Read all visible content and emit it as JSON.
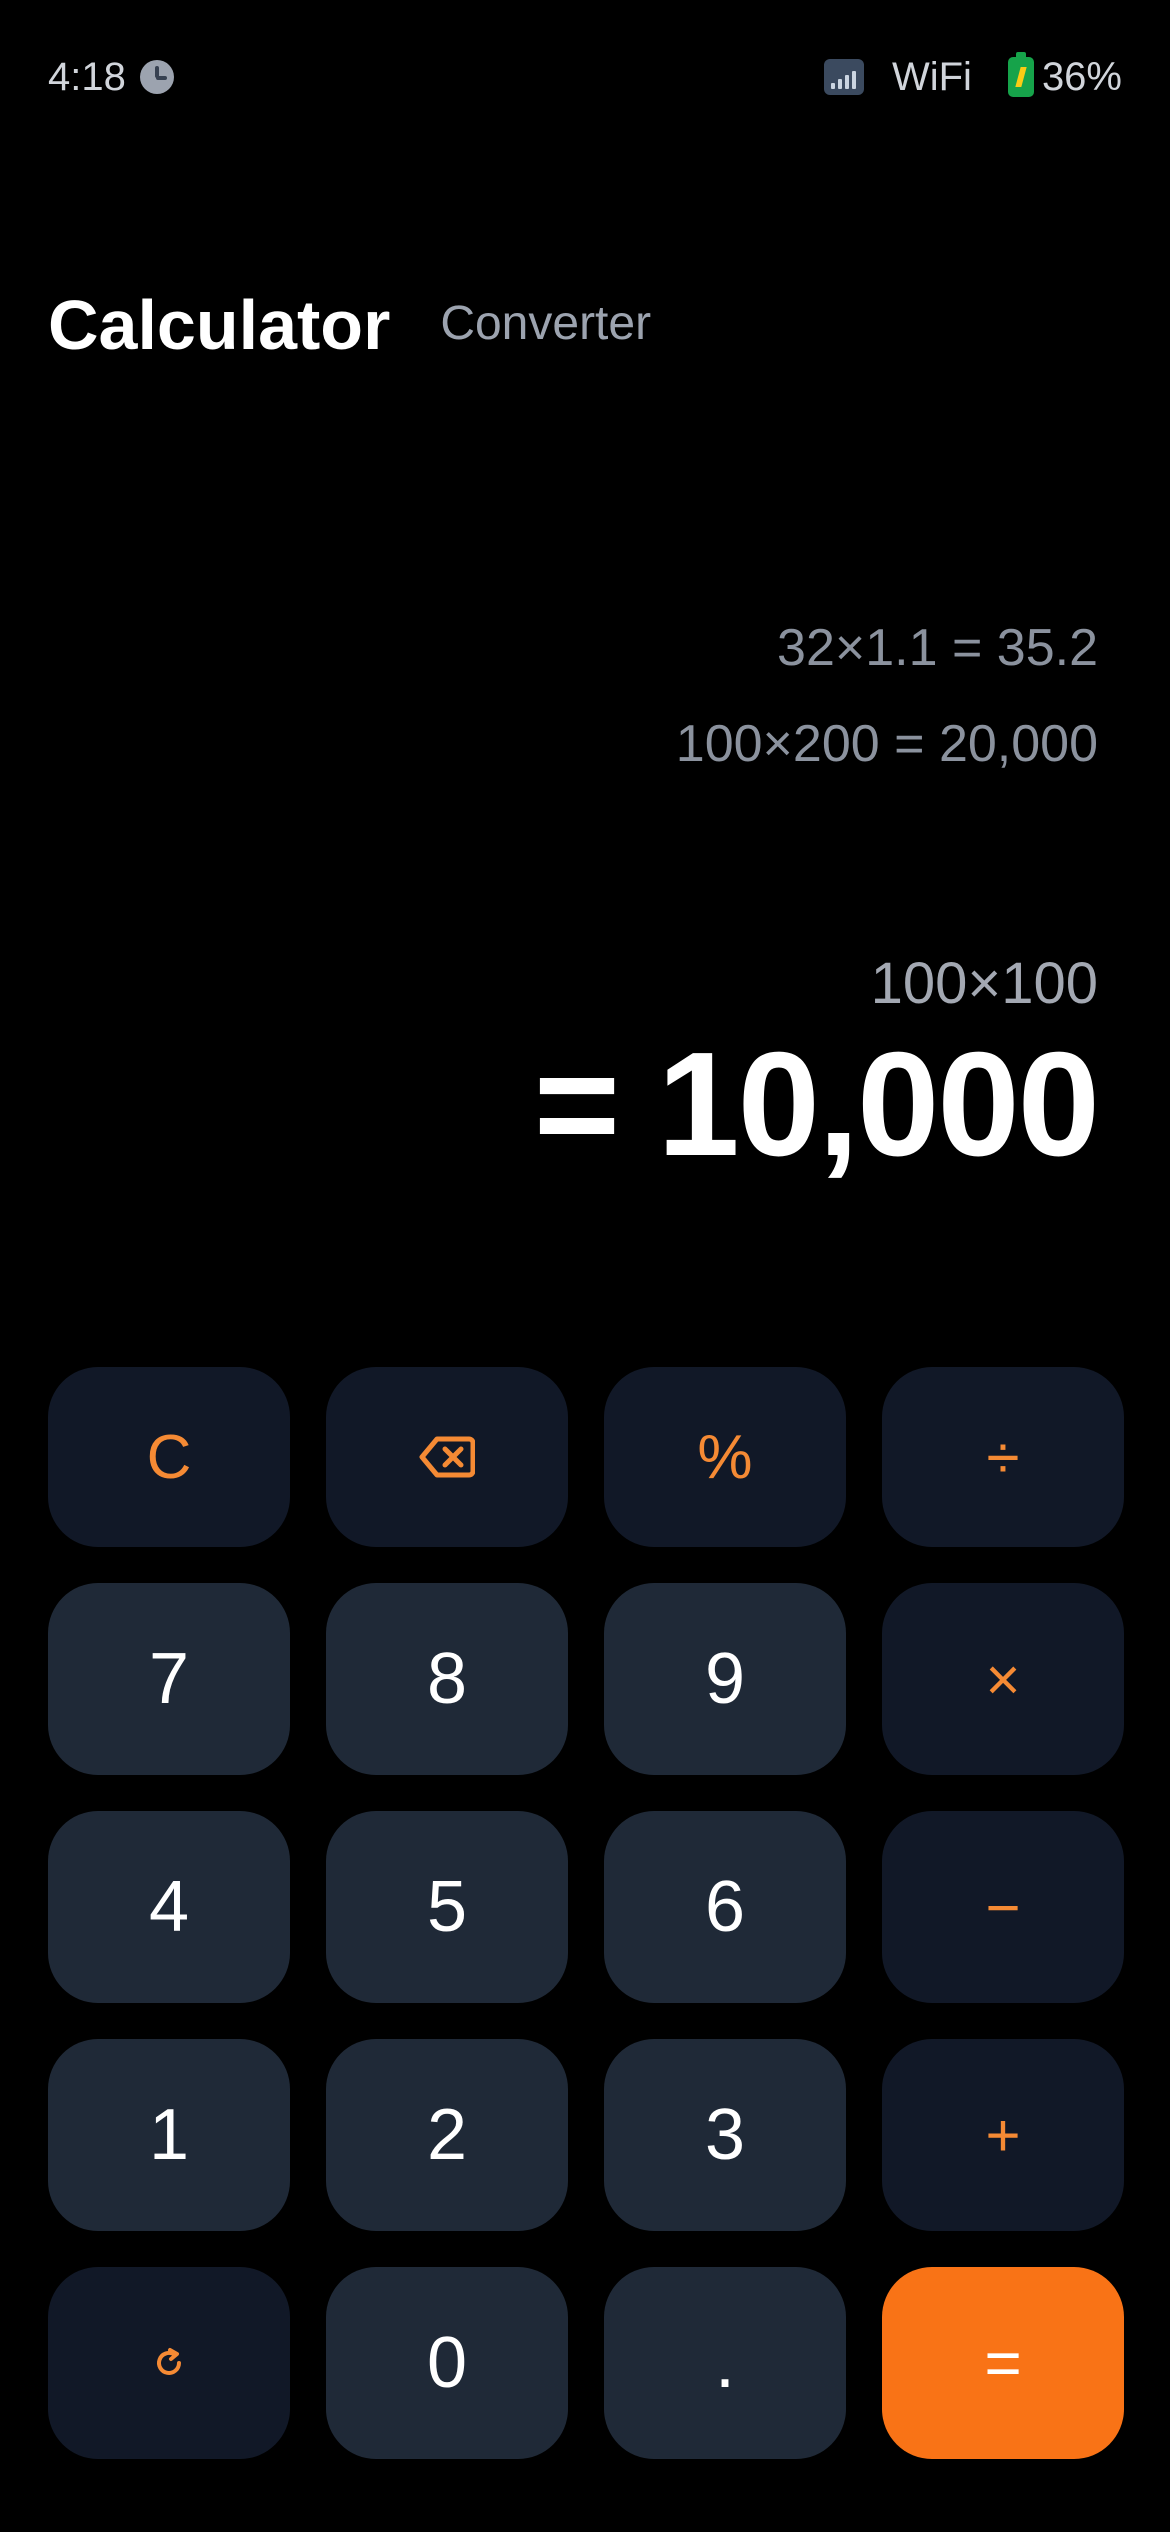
{
  "status_bar": {
    "time": "4:18",
    "wifi_label": "WiFi",
    "battery_percent": "36%",
    "clock_icon": "clock-icon",
    "signal_icon": "signal-icon",
    "battery_icon": "battery-icon"
  },
  "tabs": {
    "calculator": "Calculator",
    "converter": "Converter",
    "active": "Calculator"
  },
  "history": [
    "32×1.1 = 35.2",
    "100×200 = 20,000"
  ],
  "current": {
    "expression": "100×100",
    "result": "= 10,000"
  },
  "keypad": {
    "clear": "C",
    "backspace_icon": "backspace-icon",
    "percent": "%",
    "divide": "÷",
    "seven": "7",
    "eight": "8",
    "nine": "9",
    "multiply": "×",
    "four": "4",
    "five": "5",
    "six": "6",
    "minus": "−",
    "one": "1",
    "two": "2",
    "three": "3",
    "plus": "+",
    "refresh_icon": "refresh-icon",
    "zero": "0",
    "decimal": ".",
    "equals": "="
  },
  "colors": {
    "background": "#000000",
    "number_key": "#1f2937",
    "function_key": "#111827",
    "accent": "#f97316",
    "operator_text": "#f58a34",
    "secondary_text": "#9ca3af"
  }
}
